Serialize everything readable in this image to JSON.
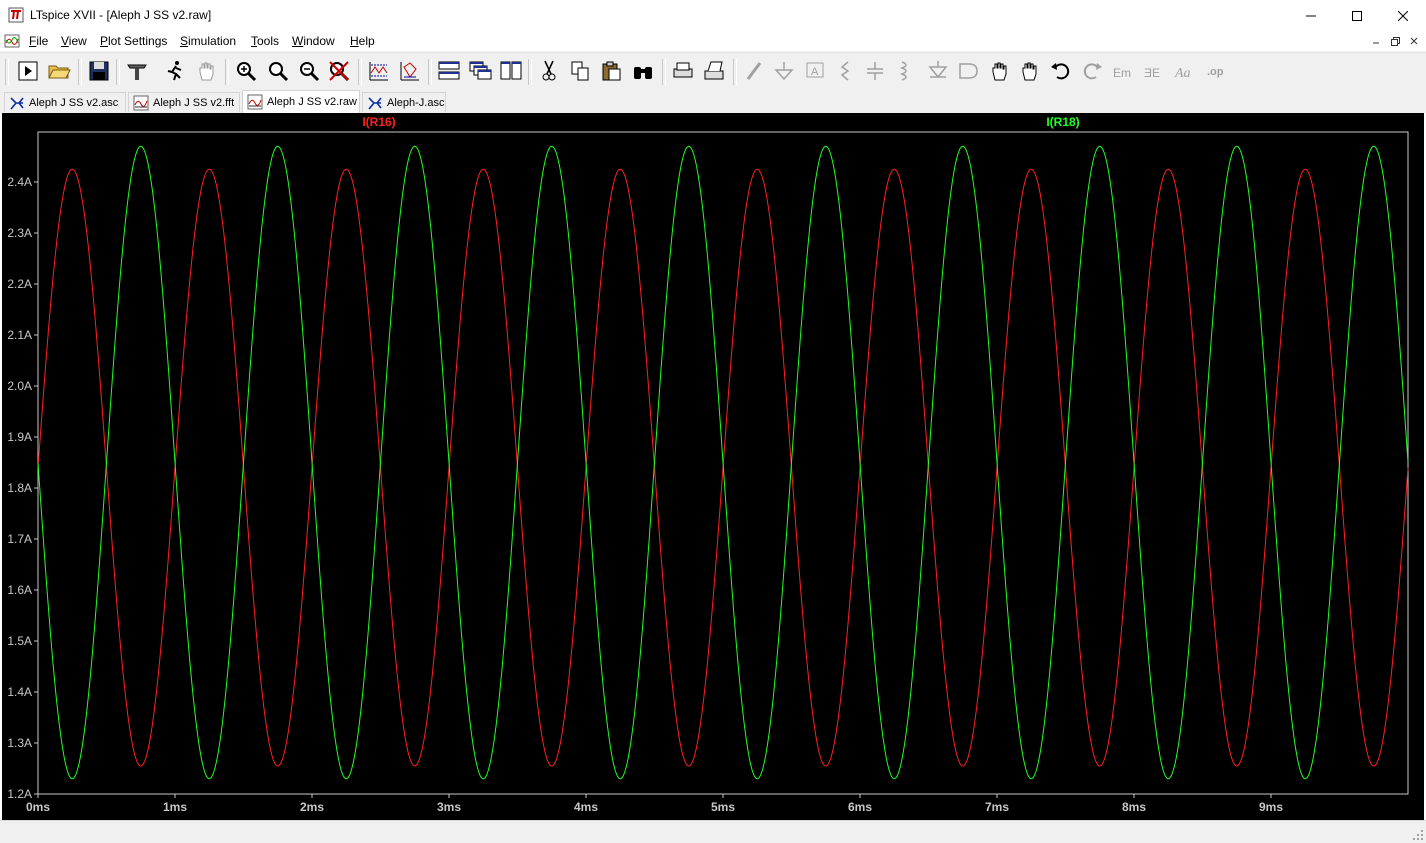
{
  "window": {
    "title": "LTspice XVII - [Aleph J SS v2.raw]"
  },
  "menu": [
    "File",
    "View",
    "Plot Settings",
    "Simulation",
    "Tools",
    "Window",
    "Help"
  ],
  "menu_underline": [
    "F",
    "V",
    "P",
    "S",
    "T",
    "W",
    "H"
  ],
  "toolbar": {
    "icons": [
      "run-icon",
      "open-icon",
      "save-icon",
      "control-panel-icon",
      "run-simulation-icon",
      "pan-hand-icon",
      "zoom-in-icon",
      "zoom-fit-icon",
      "zoom-out-icon",
      "cancel-zoom-icon",
      "autorange-icon",
      "manual-limits-icon",
      "tile-horizontal-icon",
      "cascade-icon",
      "tile-vertical-icon",
      "cut-icon",
      "copy-icon",
      "paste-icon",
      "find-icon",
      "print-icon",
      "print-setup-icon",
      "wire-icon",
      "ground-icon",
      "label-net-icon",
      "resistor-icon",
      "capacitor-icon",
      "inductor-icon",
      "diode-icon",
      "component-icon",
      "move-icon",
      "drag-icon",
      "undo-icon",
      "redo-icon",
      "rotate-icon",
      "mirror-icon",
      "text-icon",
      "spice-directive-icon"
    ]
  },
  "tabs": [
    {
      "label": "Aleph J SS v2.asc",
      "icon": "schematic-icon",
      "active": false
    },
    {
      "label": "Aleph J SS v2.fft",
      "icon": "waveform-icon",
      "active": false
    },
    {
      "label": "Aleph J SS v2.raw",
      "icon": "waveform-icon",
      "active": true
    },
    {
      "label": "Aleph-J.asc",
      "icon": "schematic-icon",
      "active": false
    }
  ],
  "colors": {
    "background": "#000000",
    "axis": "#c8c8c8",
    "trace_r16": "#ff2020",
    "trace_r18": "#20ff20"
  },
  "chart_data": {
    "type": "line",
    "title": "",
    "xlabel": "",
    "ylabel": "",
    "xlim": [
      0,
      10
    ],
    "ylim": [
      1.2,
      2.5
    ],
    "x_unit": "ms",
    "x_ticks": [
      "0ms",
      "1ms",
      "2ms",
      "3ms",
      "4ms",
      "5ms",
      "6ms",
      "7ms",
      "8ms",
      "9ms"
    ],
    "y_ticks": [
      "1.2A",
      "1.3A",
      "1.4A",
      "1.5A",
      "1.6A",
      "1.7A",
      "1.8A",
      "1.9A",
      "2.0A",
      "2.1A",
      "2.2A",
      "2.3A",
      "2.4A"
    ],
    "y_tick_values": [
      1.2,
      1.3,
      1.4,
      1.5,
      1.6,
      1.7,
      1.8,
      1.9,
      2.0,
      2.1,
      2.2,
      2.3,
      2.4
    ],
    "grid": false,
    "series": [
      {
        "name": "I(R16)",
        "color": "#ff2020",
        "waveform": "sine",
        "frequency_khz": 1.0,
        "offset": 1.84,
        "amplitude": 0.585,
        "phase": "starts rising at 0ms",
        "peak_ms": [
          0.25,
          1.25,
          2.25,
          3.25,
          4.25,
          5.25,
          6.25,
          7.25,
          8.25,
          9.25
        ],
        "peak_value": 2.425,
        "trough_value": 1.255
      },
      {
        "name": "I(R18)",
        "color": "#20ff20",
        "waveform": "sine",
        "frequency_khz": 1.0,
        "offset": 1.85,
        "amplitude": 0.62,
        "phase": "starts falling at 0ms",
        "peak_ms": [
          0.75,
          1.75,
          2.75,
          3.75,
          4.75,
          5.75,
          6.75,
          7.75,
          8.75,
          9.75
        ],
        "peak_value": 2.47,
        "trough_value": 1.23
      }
    ]
  }
}
